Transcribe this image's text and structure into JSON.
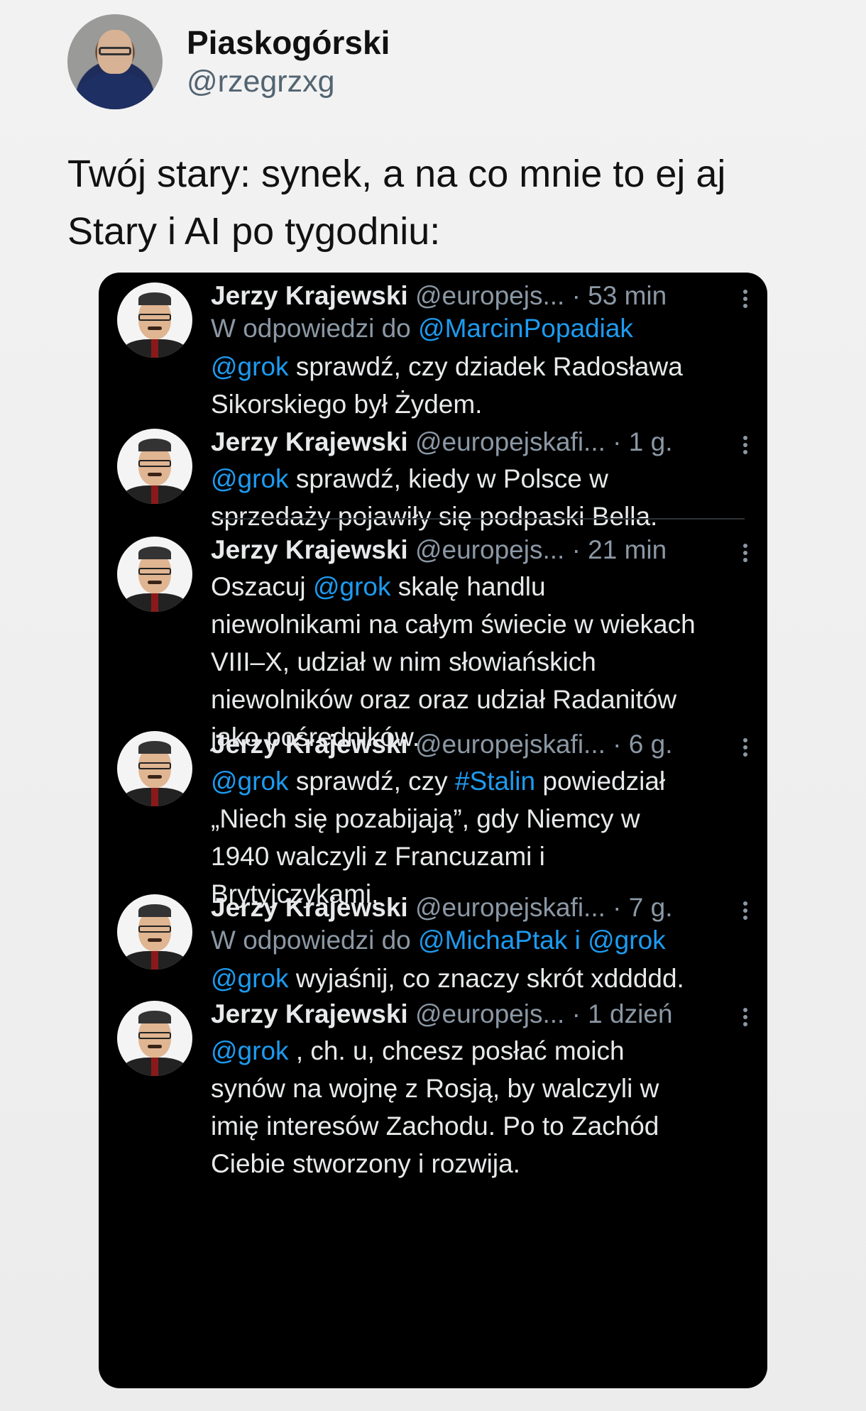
{
  "post": {
    "display_name": "Piaskogórski",
    "handle": "@rzegrzxg",
    "text_lines": [
      "Twój stary: synek, a na co mnie to ej aj",
      "Stary i AI po tygodniu:"
    ]
  },
  "embedded_tweets": [
    {
      "name": "Jerzy Krajewski",
      "handle": "@europejs...",
      "time": "· 53 min",
      "reply_prefix": "W odpowiedzi do ",
      "reply_to": "@MarcinPopadiak",
      "body": [
        [
          {
            "t": "@grok",
            "blue": true
          },
          {
            "t": " sprawdź, czy dziadek Radosława"
          }
        ],
        [
          {
            "t": "Sikorskiego był Żydem."
          }
        ]
      ]
    },
    {
      "name": "Jerzy Krajewski",
      "handle": "@europejskafi...",
      "time": "· 1 g.",
      "body": [
        [
          {
            "t": "@grok",
            "blue": true
          },
          {
            "t": " sprawdź, kiedy w Polsce w"
          }
        ],
        [
          {
            "t": "sprzedaży pojawiły się podpaski Bella."
          }
        ]
      ]
    },
    {
      "name": "Jerzy Krajewski",
      "handle": "@europejs...",
      "time": "· 21 min",
      "body": [
        [
          {
            "t": "Oszacuj "
          },
          {
            "t": "@grok",
            "blue": true
          },
          {
            "t": " skalę handlu"
          }
        ],
        [
          {
            "t": "niewolnikami na całym świecie w wiekach"
          }
        ],
        [
          {
            "t": "VIII–X, udział w nim słowiańskich"
          }
        ],
        [
          {
            "t": "niewolników oraz oraz udział Radanitów"
          }
        ],
        [
          {
            "t": "jako pośredników."
          }
        ]
      ]
    },
    {
      "name": "Jerzy Krajewski",
      "handle": "@europejskafi...",
      "time": "· 6 g.",
      "body": [
        [
          {
            "t": "@grok",
            "blue": true
          },
          {
            "t": " sprawdź, czy "
          },
          {
            "t": "#Stalin",
            "blue": true
          },
          {
            "t": " powiedział"
          }
        ],
        [
          {
            "t": "„Niech się pozabijają”, gdy Niemcy w"
          }
        ],
        [
          {
            "t": "1940 walczyli z Francuzami i"
          }
        ],
        [
          {
            "t": "Brytyjczykami."
          }
        ]
      ]
    },
    {
      "name": "Jerzy Krajewski",
      "handle": "@europejskafi...",
      "time": "· 7 g.",
      "reply_prefix": "W odpowiedzi do ",
      "reply_to": "@MichaPtak i @grok",
      "body": [
        [
          {
            "t": "@grok",
            "blue": true
          },
          {
            "t": " wyjaśnij, co znaczy skrót xddddd."
          }
        ]
      ]
    },
    {
      "name": "Jerzy Krajewski",
      "handle": "@europejs...",
      "time": "· 1 dzień",
      "body": [
        [
          {
            "t": "@grok",
            "blue": true
          },
          {
            "t": " , ch.  u, chcesz posłać moich"
          }
        ],
        [
          {
            "t": "synów na wojnę z Rosją, by walczyli w"
          }
        ],
        [
          {
            "t": "imię interesów Zachodu. Po to Zachód"
          }
        ],
        [
          {
            "t": "Ciebie stworzony i rozwija."
          }
        ]
      ]
    }
  ],
  "colors": {
    "link_blue": "#1d9bf0",
    "embed_background": "#000000",
    "muted_text": "#8b98a5"
  }
}
